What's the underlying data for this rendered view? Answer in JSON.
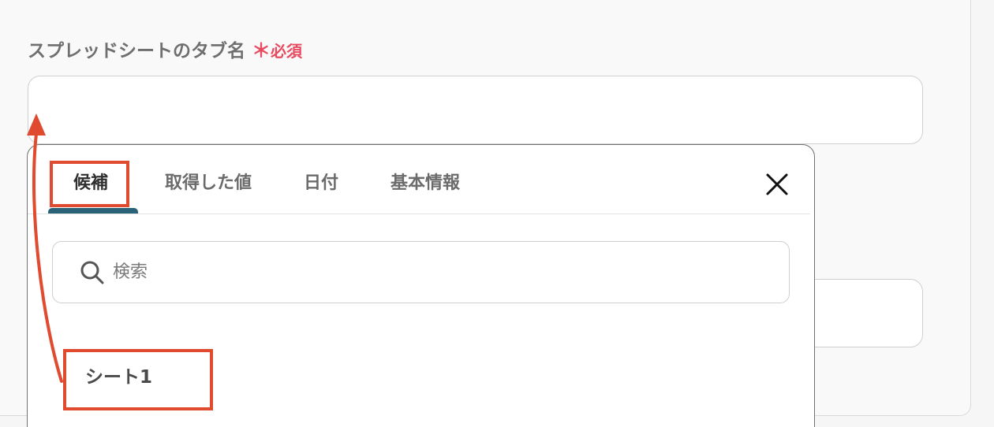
{
  "field": {
    "label": "スプレッドシートのタブ名",
    "required_mark": "＊",
    "required_text": "必須",
    "value": ""
  },
  "popup": {
    "tabs": [
      {
        "label": "候補",
        "active": true
      },
      {
        "label": "取得した値",
        "active": false
      },
      {
        "label": "日付",
        "active": false
      },
      {
        "label": "基本情報",
        "active": false
      }
    ],
    "close_icon": "close-icon",
    "search": {
      "placeholder": "検索",
      "value": "",
      "icon": "search-icon"
    },
    "items": [
      {
        "label": "シート1"
      }
    ]
  },
  "colors": {
    "accent_underline": "#2a6378",
    "required": "#e84a5f",
    "annotation": "#e04a2f"
  }
}
